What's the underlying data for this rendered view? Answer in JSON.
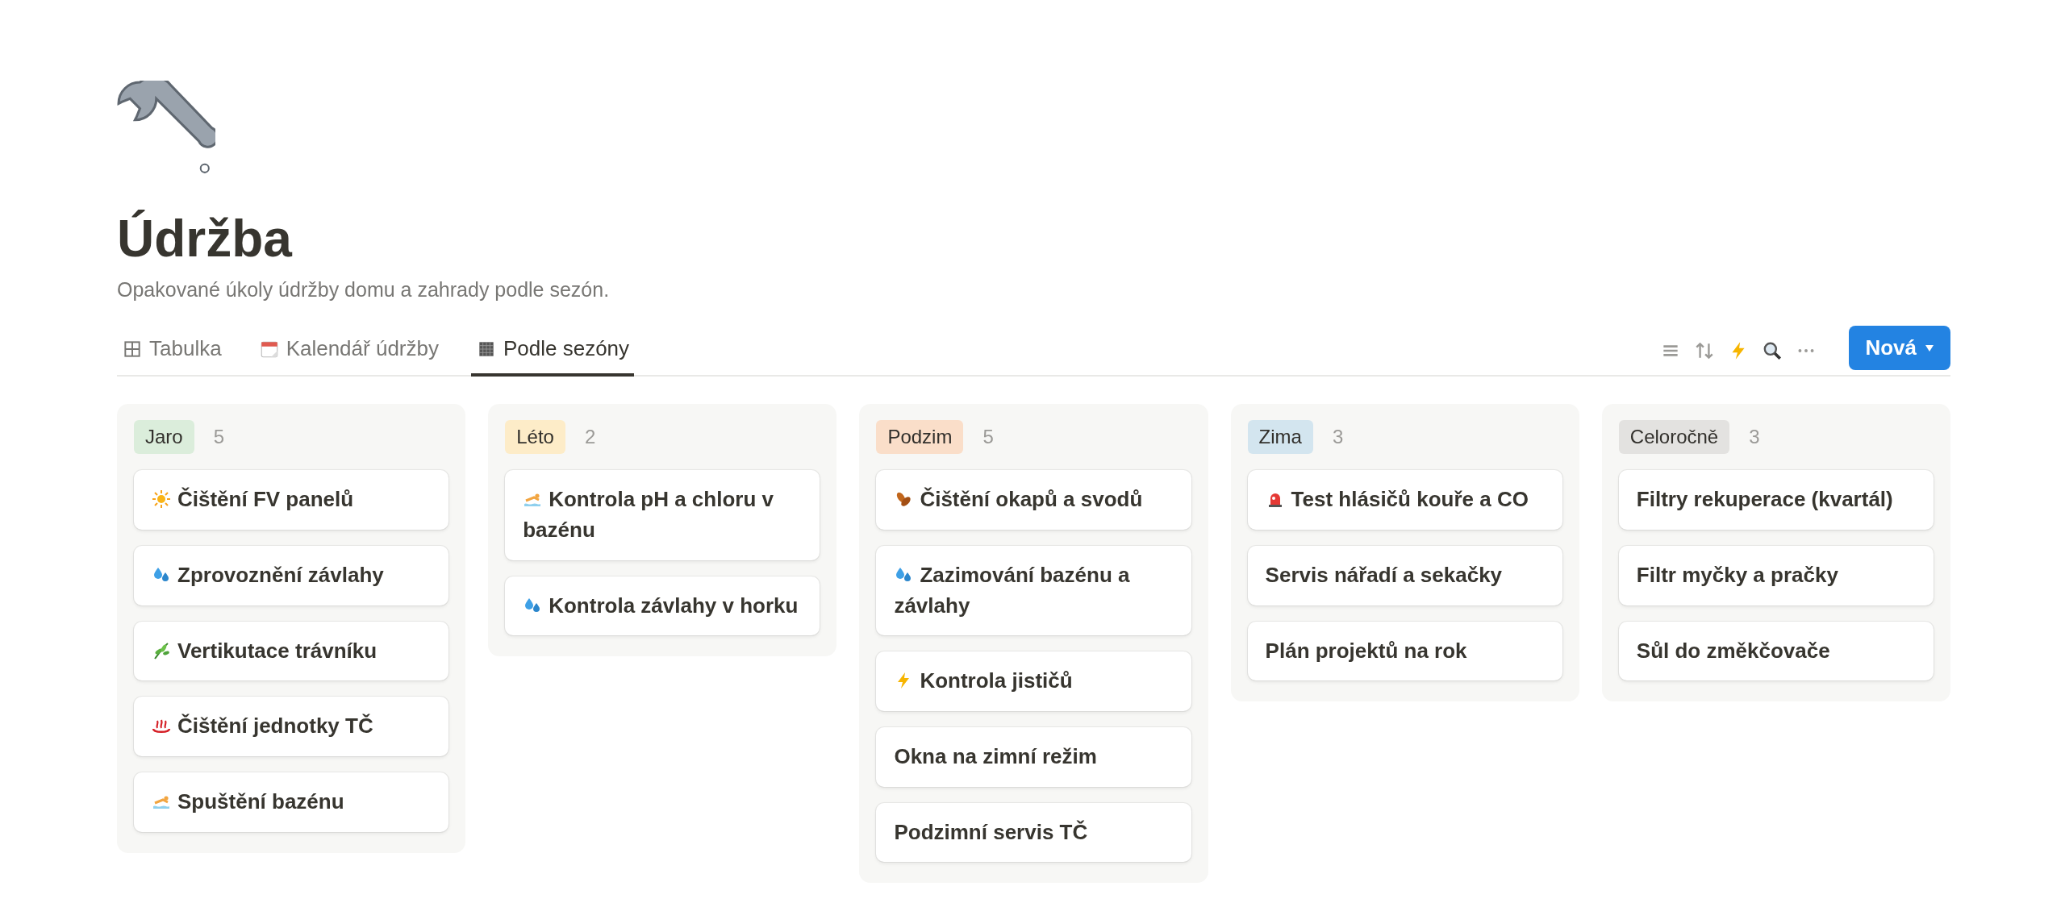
{
  "page": {
    "title": "Údržba",
    "description": "Opakované úkoly údržby domu a zahrady podle sezón."
  },
  "tabs": [
    {
      "label": "Tabulka",
      "kind": "grid",
      "selected": false
    },
    {
      "label": "Kalendář údržby",
      "kind": "calendar",
      "selected": false
    },
    {
      "label": "Podle sezóny",
      "kind": "board",
      "selected": true
    }
  ],
  "new_button": {
    "label": "Nová"
  },
  "columns": [
    {
      "name": "Jaro",
      "count": "5",
      "color": "#dbeddb",
      "cards": [
        {
          "title": "Čištění FV panelů",
          "kind": "sun"
        },
        {
          "title": "Zprovoznění závlahy",
          "kind": "drops"
        },
        {
          "title": "Vertikutace trávníku",
          "kind": "herb"
        },
        {
          "title": "Čištění jednotky TČ",
          "kind": "steam"
        },
        {
          "title": "Spuštění bazénu",
          "kind": "swimmer"
        }
      ]
    },
    {
      "name": "Léto",
      "count": "2",
      "color": "#fdecc8",
      "cards": [
        {
          "title": "Kontrola pH a chloru v bazénu",
          "kind": "swimmer"
        },
        {
          "title": "Kontrola závlahy v horku",
          "kind": "drops"
        }
      ]
    },
    {
      "name": "Podzim",
      "count": "5",
      "color": "#fadec9",
      "cards": [
        {
          "title": "Čištění okapů a svodů",
          "kind": "leaves"
        },
        {
          "title": "Zazimování bazénu a závlahy",
          "kind": "drops"
        },
        {
          "title": "Kontrola jističů",
          "kind": "bolt"
        },
        {
          "title": "Okna na zimní režim"
        },
        {
          "title": "Podzimní servis TČ"
        }
      ]
    },
    {
      "name": "Zima",
      "count": "3",
      "color": "#d3e5ef",
      "cards": [
        {
          "title": "Test hlásičů kouře a CO",
          "kind": "siren"
        },
        {
          "title": "Servis nářadí a sekačky"
        },
        {
          "title": "Plán projektů na rok"
        }
      ]
    },
    {
      "name": "Celoročně",
      "count": "3",
      "color": "#e3e2e0",
      "cards": [
        {
          "title": "Filtry rekuperace (kvartál)"
        },
        {
          "title": "Filtr myčky a pračky"
        },
        {
          "title": "Sůl do změkčovače"
        }
      ]
    }
  ]
}
